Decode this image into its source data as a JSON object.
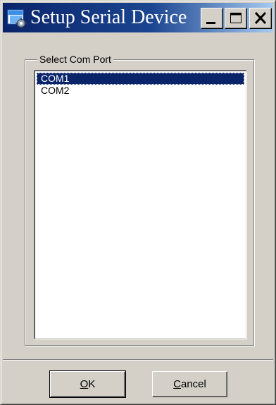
{
  "window": {
    "title": "Setup Serial Device",
    "icon": "setup-gear-window-icon"
  },
  "caption_buttons": {
    "minimize": "minimize-icon",
    "maximize": "maximize-icon",
    "close": "close-icon"
  },
  "group": {
    "label": "Select Com Port"
  },
  "ports": {
    "items": [
      "COM1",
      "COM2"
    ],
    "selected": "COM1"
  },
  "buttons": {
    "ok": {
      "mnemonic": "O",
      "rest": "K"
    },
    "cancel": {
      "mnemonic": "C",
      "rest": "ancel"
    }
  },
  "colors": {
    "title_bar_start": "#0a246a",
    "title_bar_end": "#a6caf0",
    "selection": "#0a246a",
    "face": "#d4d0c8"
  }
}
